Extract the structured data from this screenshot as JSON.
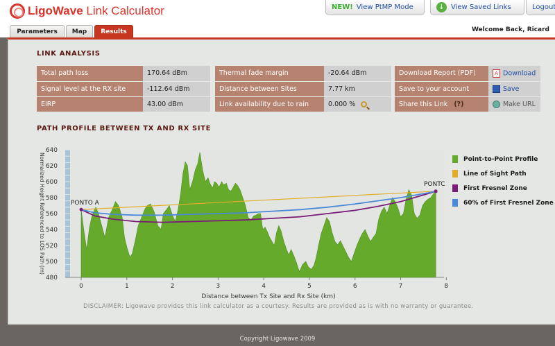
{
  "app": {
    "brand_bold": "LigoWave",
    "brand_rest": " Link Calculator"
  },
  "top_links": {
    "new_badge": "NEW!",
    "ptmp": "View PtMP Mode",
    "saved": "View Saved Links",
    "logout": "Logout"
  },
  "tabs": [
    {
      "label": "Parameters"
    },
    {
      "label": "Map"
    },
    {
      "label": "Results"
    }
  ],
  "welcome": "Welcome Back, Ricard",
  "link_analysis": {
    "title": "LINK ANALYSIS",
    "col1": [
      {
        "label": "Total path loss",
        "value": "170.64 dBm"
      },
      {
        "label": "Signal level at the RX site",
        "value": "-112.64 dBm"
      },
      {
        "label": "EIRP",
        "value": "43.00 dBm"
      }
    ],
    "col2": [
      {
        "label": "Thermal fade margin",
        "value": "-20.64 dBm"
      },
      {
        "label": "Distance between Sites",
        "value": "7.77 km"
      },
      {
        "label": "Link availability due to rain",
        "value": "0.000 %"
      }
    ],
    "col3": [
      {
        "label": "Download Report (PDF)",
        "action": "Download"
      },
      {
        "label": "Save to your account",
        "action": "Save"
      },
      {
        "label": "Share this Link",
        "hint": "(?)",
        "action": "Make URL"
      }
    ]
  },
  "path_profile": {
    "title": "PATH PROFILE BETWEEN TX AND RX SITE"
  },
  "chart_data": {
    "type": "area",
    "xlabel": "Distance between Tx Site and Rx Site (km)",
    "ylabel": "Normalized Height Referenced to LOS Path (m)",
    "xlim": [
      -0.35,
      7.95
    ],
    "ylim": [
      480,
      640
    ],
    "yticks": [
      "640",
      "620",
      "600",
      "580",
      "560",
      "540",
      "520",
      "500",
      "480"
    ],
    "xticks": [
      "0",
      "1",
      "2",
      "3",
      "4",
      "5",
      "6",
      "7",
      "8"
    ],
    "annotations": {
      "site_a": "PONTO A",
      "site_b": "PONTC"
    },
    "series": [
      {
        "name": "Point-to-Point Profile",
        "color": "#66aa2c",
        "kind": "area",
        "x": [
          0,
          0.06,
          0.12,
          0.18,
          0.24,
          0.32,
          0.38,
          0.45,
          0.52,
          0.6,
          0.68,
          0.75,
          0.82,
          0.9,
          0.95,
          1.0,
          1.07,
          1.12,
          1.18,
          1.25,
          1.32,
          1.4,
          1.45,
          1.52,
          1.6,
          1.68,
          1.75,
          1.8,
          1.87,
          1.93,
          2.0,
          2.06,
          2.12,
          2.18,
          2.23,
          2.28,
          2.33,
          2.38,
          2.44,
          2.5,
          2.55,
          2.6,
          2.66,
          2.72,
          2.78,
          2.82,
          2.88,
          2.92,
          2.97,
          3.02,
          3.08,
          3.12,
          3.18,
          3.23,
          3.28,
          3.33,
          3.38,
          3.43,
          3.48,
          3.54,
          3.6,
          3.66,
          3.72,
          3.78,
          3.83,
          3.88,
          3.93,
          3.98,
          4.03,
          4.08,
          4.13,
          4.18,
          4.23,
          4.28,
          4.33,
          4.38,
          4.44,
          4.5,
          4.55,
          4.6,
          4.66,
          4.72,
          4.78,
          4.85,
          4.92,
          4.98,
          5.04,
          5.1,
          5.15,
          5.2,
          5.26,
          5.32,
          5.38,
          5.44,
          5.5,
          5.56,
          5.62,
          5.68,
          5.74,
          5.8,
          5.86,
          5.92,
          5.98,
          6.04,
          6.1,
          6.16,
          6.22,
          6.28,
          6.34,
          6.4,
          6.46,
          6.52,
          6.58,
          6.64,
          6.7,
          6.76,
          6.82,
          6.88,
          6.94,
          7.0,
          7.06,
          7.12,
          7.18,
          7.24,
          7.3,
          7.36,
          7.42,
          7.48,
          7.54,
          7.6,
          7.66,
          7.72,
          7.77
        ],
        "values": [
          565,
          538,
          515,
          542,
          558,
          568,
          560,
          545,
          530,
          555,
          565,
          575,
          570,
          555,
          530,
          518,
          505,
          510,
          525,
          545,
          555,
          566,
          570,
          572,
          562,
          545,
          540,
          560,
          565,
          570,
          558,
          550,
          564,
          585,
          610,
          625,
          620,
          590,
          600,
          615,
          622,
          637,
          615,
          600,
          605,
          598,
          592,
          600,
          598,
          593,
          600,
          596,
          598,
          590,
          588,
          593,
          598,
          595,
          590,
          580,
          570,
          555,
          552,
          557,
          558,
          560,
          560,
          540,
          543,
          537,
          530,
          525,
          520,
          536,
          545,
          538,
          525,
          515,
          508,
          515,
          507,
          498,
          487,
          496,
          500,
          493,
          490,
          495,
          505,
          520,
          535,
          545,
          555,
          550,
          536,
          525,
          521,
          526,
          519,
          512,
          505,
          500,
          510,
          520,
          528,
          535,
          540,
          532,
          525,
          530,
          535,
          553,
          563,
          568,
          560,
          570,
          580,
          575,
          567,
          556,
          560,
          578,
          590,
          583,
          560,
          554,
          558,
          570,
          575,
          578,
          580,
          585,
          588
        ]
      },
      {
        "name": "Line of Sight Path",
        "color": "#e2ae2a",
        "kind": "line",
        "x": [
          0,
          7.77
        ],
        "values": [
          565,
          588
        ]
      },
      {
        "name": "First Fresnel Zone",
        "color": "#7a1b78",
        "kind": "line",
        "x": [
          0,
          0.3,
          0.7,
          1.2,
          1.8,
          2.4,
          3.0,
          3.6,
          4.2,
          4.8,
          5.4,
          6.0,
          6.5,
          7.0,
          7.3,
          7.6,
          7.77
        ],
        "values": [
          565,
          557,
          553,
          550,
          549,
          550,
          551,
          552,
          554,
          556,
          560,
          564,
          569,
          575,
          580,
          585,
          588
        ]
      },
      {
        "name": "60% of First Fresnel Zone",
        "color": "#4a8ad8",
        "kind": "line",
        "x": [
          0,
          0.3,
          0.7,
          1.2,
          1.8,
          2.4,
          3.0,
          3.6,
          4.2,
          4.8,
          5.4,
          6.0,
          6.5,
          7.0,
          7.3,
          7.6,
          7.77
        ],
        "values": [
          565,
          561,
          559,
          558,
          558,
          559,
          560,
          561,
          563,
          565,
          568,
          572,
          576,
          580,
          583,
          586,
          588
        ]
      }
    ]
  },
  "disclaimer": "DISCLAIMER: Ligowave provides this link calculator as a courtesy. Results are provided as is with no warranty or guarantee.",
  "footer": "Copyright Ligowave 2009"
}
